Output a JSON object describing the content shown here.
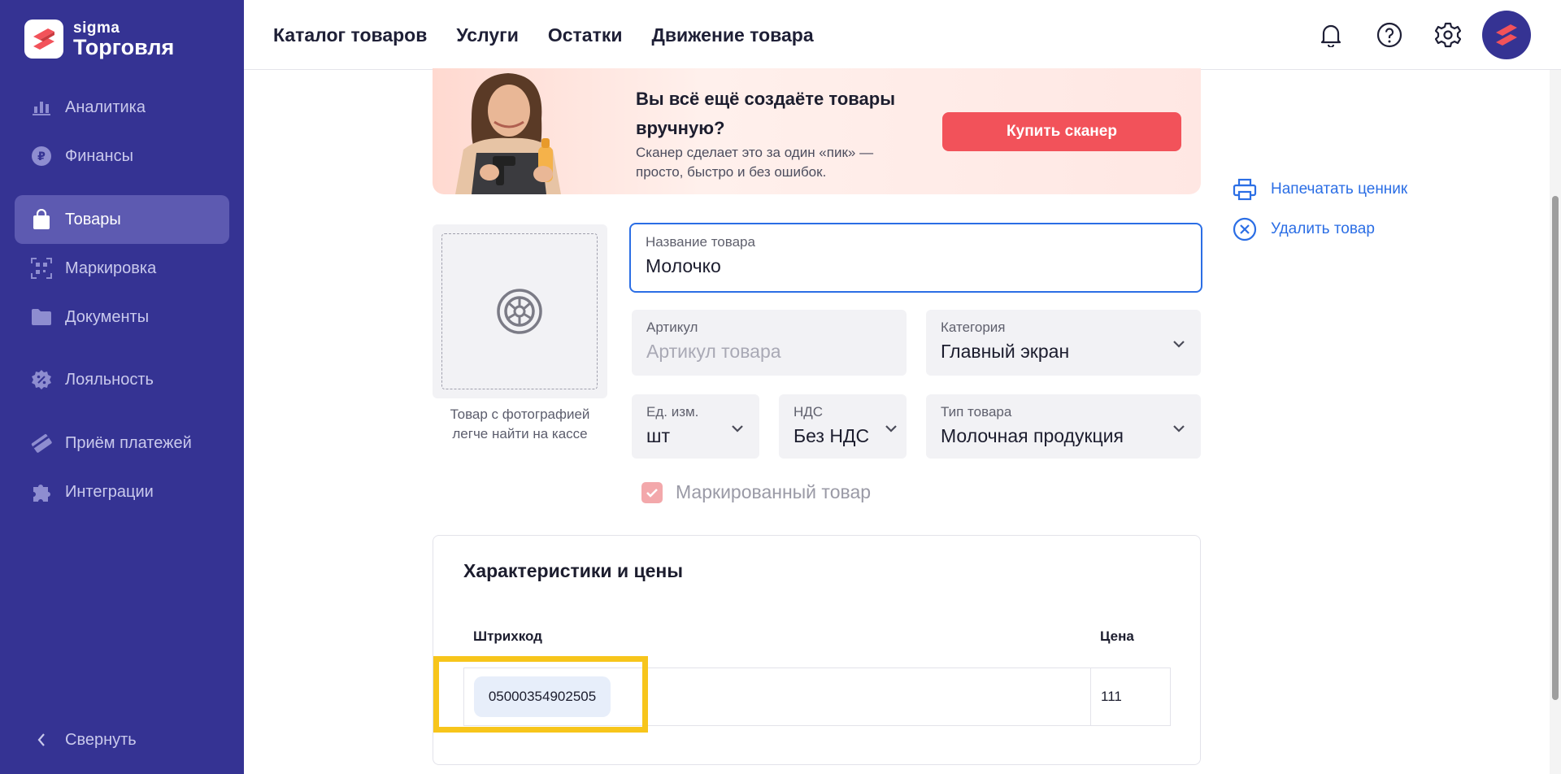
{
  "brand": {
    "small": "sigma",
    "big": "Торговля"
  },
  "sidebar": {
    "items": [
      {
        "label": "Аналитика",
        "icon": "bar-chart-icon"
      },
      {
        "label": "Финансы",
        "icon": "ruble-coin-icon"
      },
      {
        "label": "Товары",
        "icon": "shopping-bag-icon",
        "active": true
      },
      {
        "label": "Маркировка",
        "icon": "qr-scan-icon"
      },
      {
        "label": "Документы",
        "icon": "folder-icon"
      },
      {
        "label": "Лояльность",
        "icon": "discount-badge-icon"
      },
      {
        "label": "Приём платежей",
        "icon": "payment-card-icon"
      },
      {
        "label": "Интеграции",
        "icon": "puzzle-icon"
      }
    ],
    "collapse_label": "Свернуть"
  },
  "topnav": {
    "items": [
      "Каталог товаров",
      "Услуги",
      "Остатки",
      "Движение товара"
    ]
  },
  "banner": {
    "title": "Вы всё ещё создаёте товары вручную?",
    "subtitle": "Сканер сделает это за один «пик» — просто, быстро и без ошибок.",
    "button": "Купить сканер"
  },
  "photo": {
    "caption": "Товар с фотографией легче найти на кассе"
  },
  "form": {
    "name": {
      "label": "Название товара",
      "value": "Молочко"
    },
    "article": {
      "label": "Артикул",
      "placeholder": "Артикул товара"
    },
    "category": {
      "label": "Категория",
      "value": "Главный экран"
    },
    "unit": {
      "label": "Ед. изм.",
      "value": "шт"
    },
    "vat": {
      "label": "НДС",
      "value": "Без НДС"
    },
    "type": {
      "label": "Тип товара",
      "value": "Молочная продукция"
    },
    "marked": {
      "label": "Маркированный товар",
      "checked": true
    }
  },
  "actions": {
    "print": "Напечатать ценник",
    "delete": "Удалить товар"
  },
  "prices": {
    "title": "Характеристики и цены",
    "columns": {
      "barcode": "Штрихкод",
      "price": "Цена"
    },
    "rows": [
      {
        "barcode": "05000354902505",
        "price": "111"
      }
    ]
  },
  "colors": {
    "sidebar": "#353393",
    "accent": "#2b6ee5",
    "buy_button": "#f2525a",
    "highlight": "#f7c51b"
  }
}
